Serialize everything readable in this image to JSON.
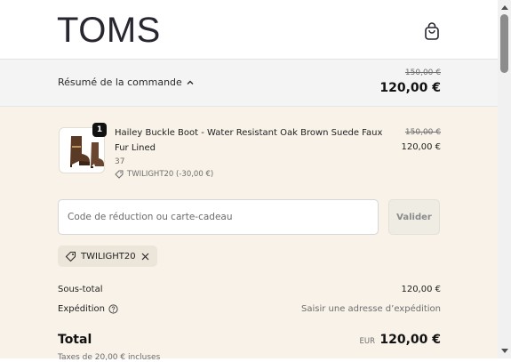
{
  "header": {
    "brand": "TOMS",
    "cart_icon": "shopping-bag-icon"
  },
  "summary": {
    "toggle_label": "Résumé de la commande",
    "toggle_icon": "chevron-up-icon",
    "original_total": "150,00 €",
    "total": "120,00 €"
  },
  "cart": {
    "items": [
      {
        "quantity": "1",
        "title": "Hailey Buckle Boot - Water Resistant Oak Brown Suede Faux Fur Lined",
        "size": "37",
        "discount_label": "TWILIGHT20 (-30,00 €)",
        "original_price": "150,00 €",
        "price": "120,00 €"
      }
    ]
  },
  "discount": {
    "placeholder": "Code de réduction ou carte-cadeau",
    "value": "",
    "apply_label": "Valider",
    "applied_code": "TWILIGHT20"
  },
  "totals": {
    "subtotal_label": "Sous-total",
    "subtotal_value": "120,00 €",
    "shipping_label": "Expédition",
    "shipping_value": "Saisir une adresse d’expédition",
    "total_label": "Total",
    "currency": "EUR",
    "total_value": "120,00 €",
    "tax_note": "Taxes de 20,00 € incluses"
  },
  "colors": {
    "summary_bg": "#f4f4f4",
    "content_bg": "#f8f2e8",
    "chip_bg": "#ebe5da",
    "text": "#1f1f1f",
    "muted": "#6e6e6e"
  }
}
